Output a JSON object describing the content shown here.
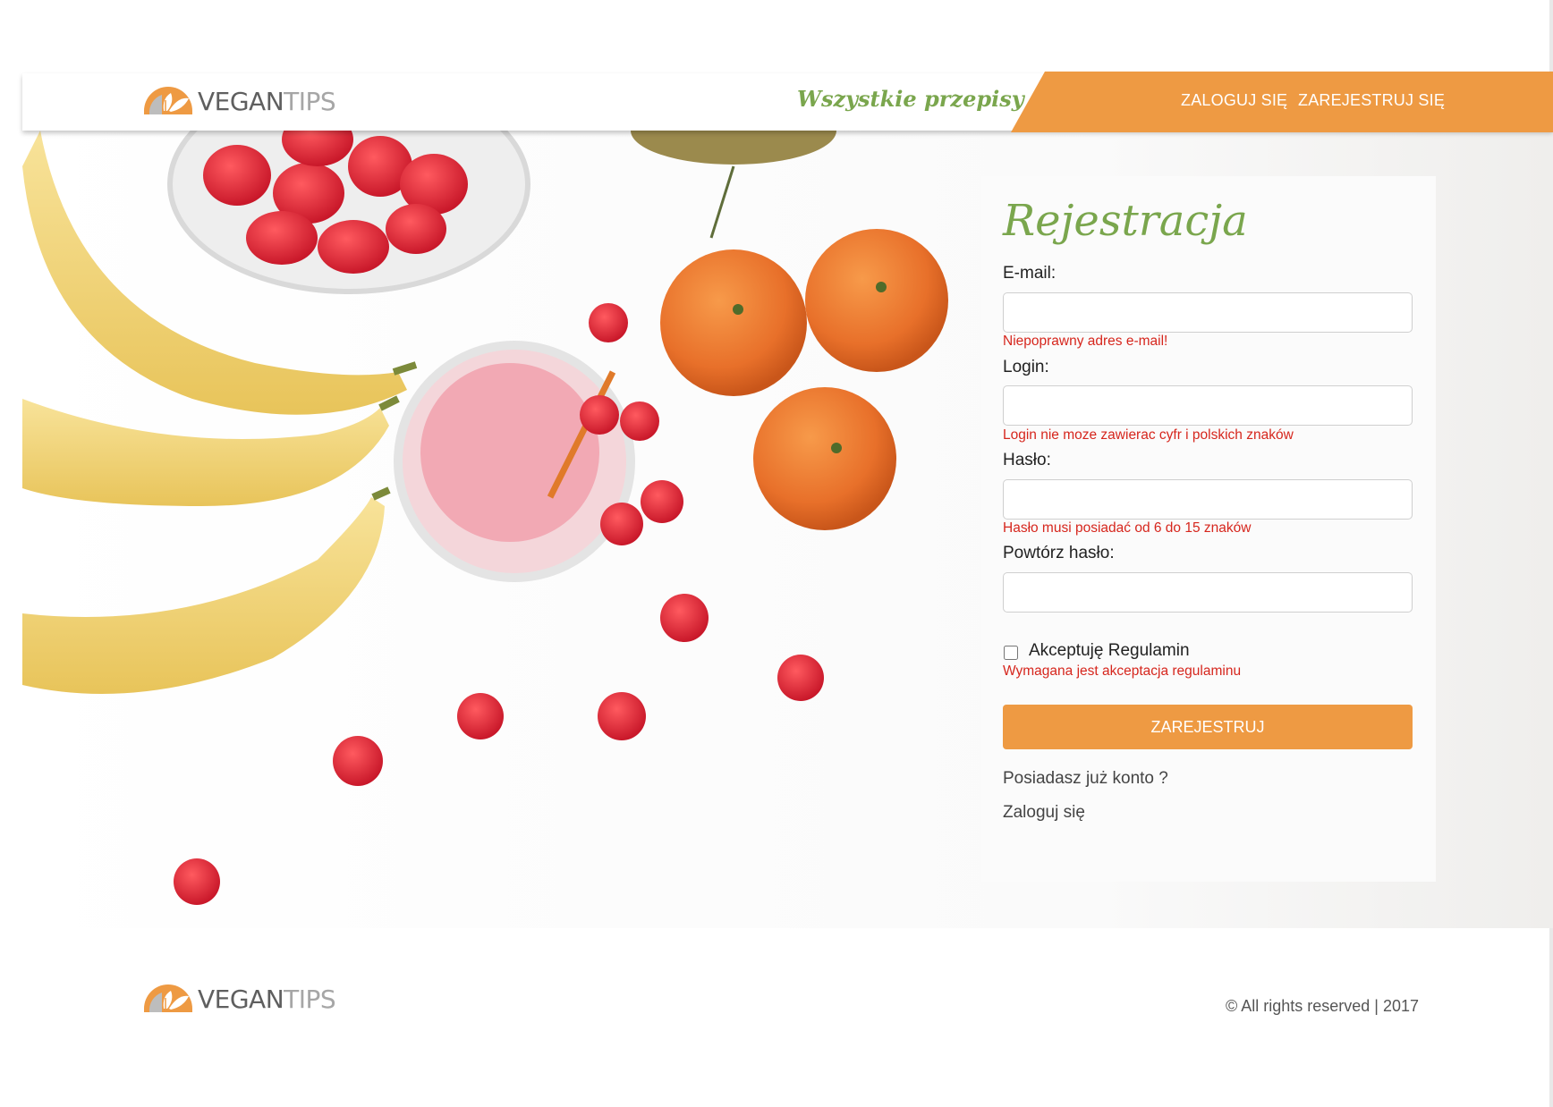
{
  "brand": {
    "logo_word_1": "VEGAN",
    "logo_word_2": "TIPS"
  },
  "header": {
    "recipes_link": "Wszystkie przepisy",
    "nav_login": "ZALOGUJ SIĘ",
    "nav_register": "ZAREJESTRUJ SIĘ"
  },
  "form": {
    "title": "Rejestracja",
    "email_label": "E-mail:",
    "email_value": "",
    "email_error": "Niepoprawny adres e-mail!",
    "login_label": "Login:",
    "login_value": "",
    "login_error": "Login nie moze zawierac cyfr i polskich znaków",
    "password_label": "Hasło:",
    "password_value": "",
    "password_error": "Hasło musi posiadać od 6 do 15 znaków",
    "repeat_label": "Powtórz hasło:",
    "repeat_value": "",
    "terms_label": "Akceptuję Regulamin",
    "terms_checked": false,
    "terms_error": "Wymagana jest akceptacja regulaminu",
    "submit_label": "ZAREJESTRUJ",
    "have_account": "Posiadasz już konto ?",
    "login_link": "Zaloguj się"
  },
  "footer": {
    "copyright": "© All rights reserved | 2017"
  },
  "colors": {
    "accent_orange": "#ee9a43",
    "brand_green": "#7aa64d",
    "error_red": "#d6261d"
  },
  "icons": {
    "logo": "leaf-bowl-icon",
    "checkbox": "checkbox-icon"
  }
}
